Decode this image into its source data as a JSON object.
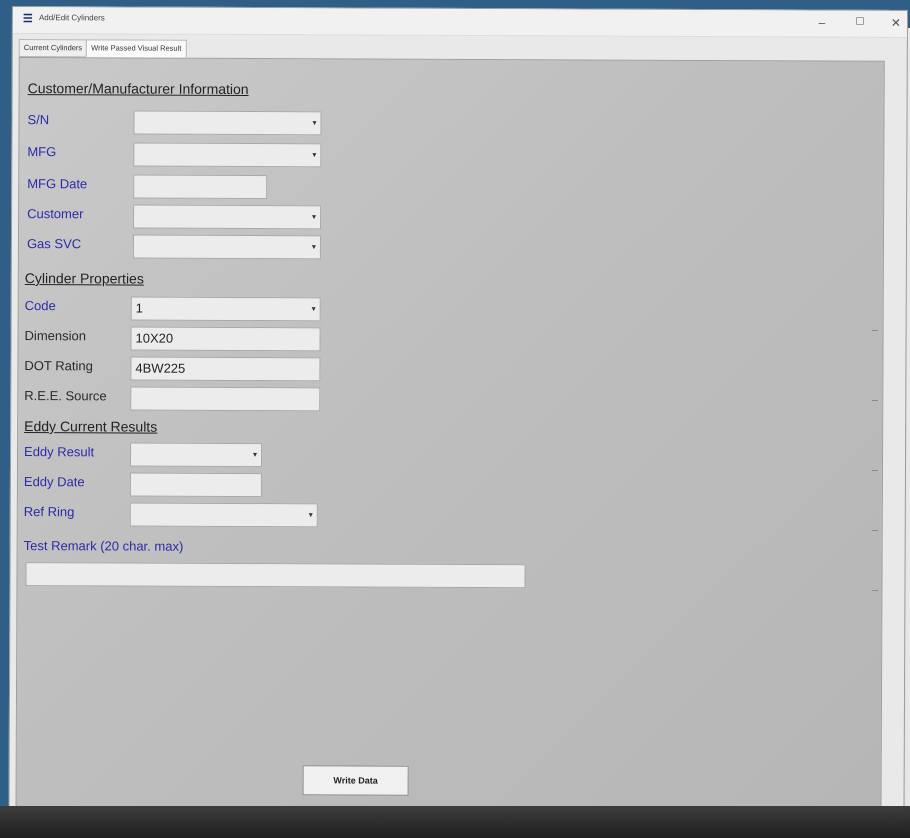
{
  "window": {
    "title": "Add/Edit Cylinders",
    "controls": {
      "minimize": "–",
      "maximize": "☐",
      "close": "✕"
    }
  },
  "tabs": [
    {
      "label": "Current Cylinders",
      "active": false
    },
    {
      "label": "Write Passed Visual Result",
      "active": true
    }
  ],
  "sections": {
    "customer": "Customer/Manufacturer Information",
    "cylinder": "Cylinder Properties",
    "eddy": "Eddy Current Results"
  },
  "fields": {
    "sn": {
      "label": "S/N",
      "value": ""
    },
    "mfg": {
      "label": "MFG",
      "value": ""
    },
    "mfg_date": {
      "label": "MFG Date",
      "value": ""
    },
    "customer": {
      "label": "Customer",
      "value": ""
    },
    "gas_svc": {
      "label": "Gas SVC",
      "value": ""
    },
    "code": {
      "label": "Code",
      "value": "1"
    },
    "dimension": {
      "label": "Dimension",
      "value": "10X20"
    },
    "dot_rating": {
      "label": "DOT Rating",
      "value": "4BW225"
    },
    "ree_source": {
      "label": "R.E.E. Source",
      "value": ""
    },
    "eddy_result": {
      "label": "Eddy Result",
      "value": ""
    },
    "eddy_date": {
      "label": "Eddy Date",
      "value": ""
    },
    "ref_ring": {
      "label": "Ref Ring",
      "value": ""
    },
    "test_remark": {
      "label": "Test Remark (20 char. max)",
      "value": ""
    }
  },
  "buttons": {
    "write_data": "Write Data"
  },
  "icons": {
    "app": "app-icon",
    "dropdown": "chevron-down-icon"
  },
  "colors": {
    "label_blue": "#2b2ba8",
    "panel": "#c2c2c2",
    "desktop": "#2f5f86"
  }
}
